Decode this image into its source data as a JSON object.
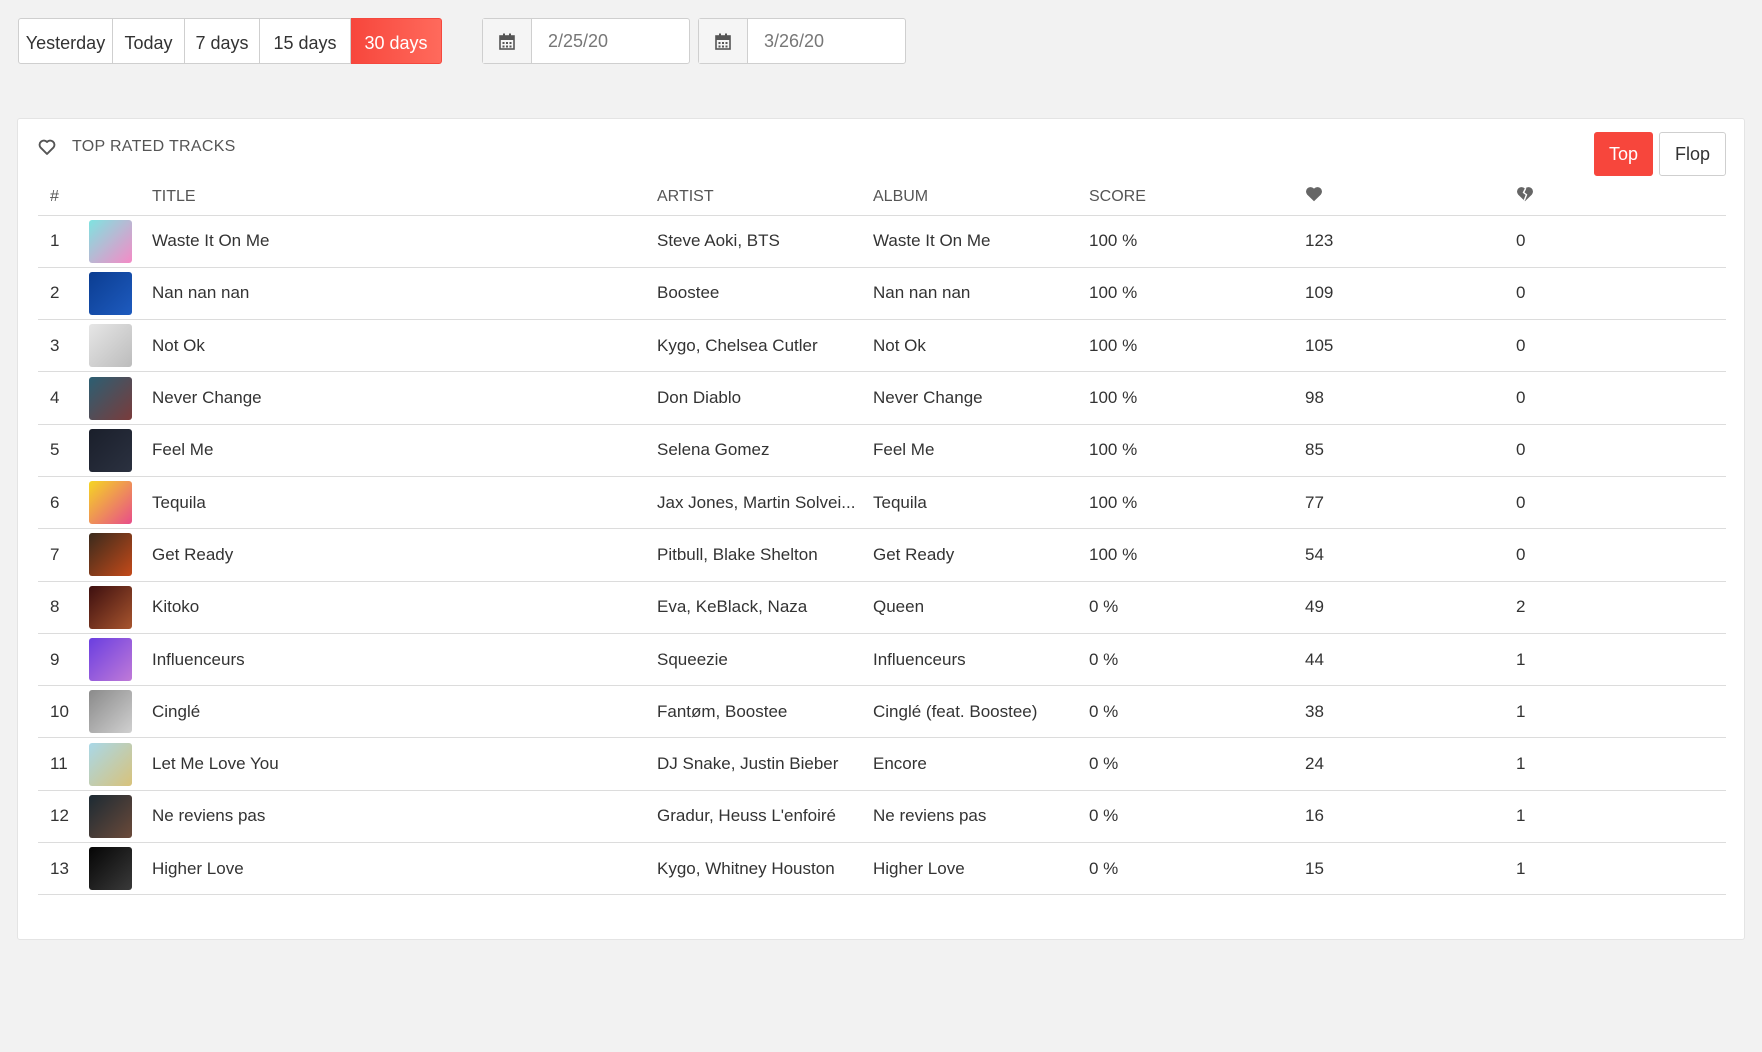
{
  "filters": {
    "ranges": [
      {
        "label": "Yesterday",
        "active": false
      },
      {
        "label": "Today",
        "active": false
      },
      {
        "label": "7 days",
        "active": false
      },
      {
        "label": "15 days",
        "active": false
      },
      {
        "label": "30 days",
        "active": true
      }
    ],
    "start_date": "2/25/20",
    "end_date": "3/26/20",
    "accent_color": "#f7463c"
  },
  "card": {
    "title": "TOP RATED TRACKS",
    "title_icon": "heart-outline-icon",
    "toggle": {
      "top_label": "Top",
      "flop_label": "Flop",
      "active": "top"
    }
  },
  "table": {
    "headers": {
      "rank": "#",
      "title": "TITLE",
      "artist": "ARTIST",
      "album": "ALBUM",
      "score": "SCORE",
      "likes_icon": "heart-icon",
      "dislikes_icon": "broken-heart-icon"
    },
    "rows": [
      {
        "rank": "1",
        "title": "Waste It On Me",
        "artist": "Steve Aoki, BTS",
        "album": "Waste It On Me",
        "score": "100 %",
        "likes": "123",
        "dislikes": "0",
        "cover": [
          "#7fe3e0",
          "#f58ac6"
        ]
      },
      {
        "rank": "2",
        "title": "Nan nan nan",
        "artist": "Boostee",
        "album": "Nan nan nan",
        "score": "100 %",
        "likes": "109",
        "dislikes": "0",
        "cover": [
          "#0b3d91",
          "#1e5bbf"
        ]
      },
      {
        "rank": "3",
        "title": "Not Ok",
        "artist": "Kygo, Chelsea Cutler",
        "album": "Not Ok",
        "score": "100 %",
        "likes": "105",
        "dislikes": "0",
        "cover": [
          "#e6e6e6",
          "#bcbcbc"
        ]
      },
      {
        "rank": "4",
        "title": "Never Change",
        "artist": "Don Diablo",
        "album": "Never Change",
        "score": "100 %",
        "likes": "98",
        "dislikes": "0",
        "cover": [
          "#2b5f73",
          "#7a3b3b"
        ]
      },
      {
        "rank": "5",
        "title": "Feel Me",
        "artist": "Selena Gomez",
        "album": "Feel Me",
        "score": "100 %",
        "likes": "85",
        "dislikes": "0",
        "cover": [
          "#1a1f2b",
          "#2b3140"
        ]
      },
      {
        "rank": "6",
        "title": "Tequila",
        "artist": "Jax Jones, Martin Solvei...",
        "album": "Tequila",
        "score": "100 %",
        "likes": "77",
        "dislikes": "0",
        "cover": [
          "#f5d623",
          "#e84d8a"
        ]
      },
      {
        "rank": "7",
        "title": "Get Ready",
        "artist": "Pitbull, Blake Shelton",
        "album": "Get Ready",
        "score": "100 %",
        "likes": "54",
        "dislikes": "0",
        "cover": [
          "#3a2a1c",
          "#c44a1a"
        ]
      },
      {
        "rank": "8",
        "title": "Kitoko",
        "artist": "Eva, KeBlack, Naza",
        "album": "Queen",
        "score": "0 %",
        "likes": "49",
        "dislikes": "2",
        "cover": [
          "#3d0f0f",
          "#a8552e"
        ]
      },
      {
        "rank": "9",
        "title": "Influenceurs",
        "artist": "Squeezie",
        "album": "Influenceurs",
        "score": "0 %",
        "likes": "44",
        "dislikes": "1",
        "cover": [
          "#6a3ee0",
          "#c07ad8"
        ]
      },
      {
        "rank": "10",
        "title": "Cinglé",
        "artist": "Fantøm, Boostee",
        "album": "Cinglé (feat. Boostee)",
        "score": "0 %",
        "likes": "38",
        "dislikes": "1",
        "cover": [
          "#8a8a8a",
          "#d0d0d0"
        ]
      },
      {
        "rank": "11",
        "title": "Let Me Love You",
        "artist": "DJ Snake, Justin Bieber",
        "album": "Encore",
        "score": "0 %",
        "likes": "24",
        "dislikes": "1",
        "cover": [
          "#a9d8e8",
          "#d8c27a"
        ]
      },
      {
        "rank": "12",
        "title": "Ne reviens pas",
        "artist": "Gradur, Heuss L'enfoiré",
        "album": "Ne reviens pas",
        "score": "0 %",
        "likes": "16",
        "dislikes": "1",
        "cover": [
          "#1c2a33",
          "#6b4a3a"
        ]
      },
      {
        "rank": "13",
        "title": "Higher Love",
        "artist": "Kygo, Whitney Houston",
        "album": "Higher Love",
        "score": "0 %",
        "likes": "15",
        "dislikes": "1",
        "cover": [
          "#050505",
          "#3a3a3a"
        ]
      }
    ]
  }
}
